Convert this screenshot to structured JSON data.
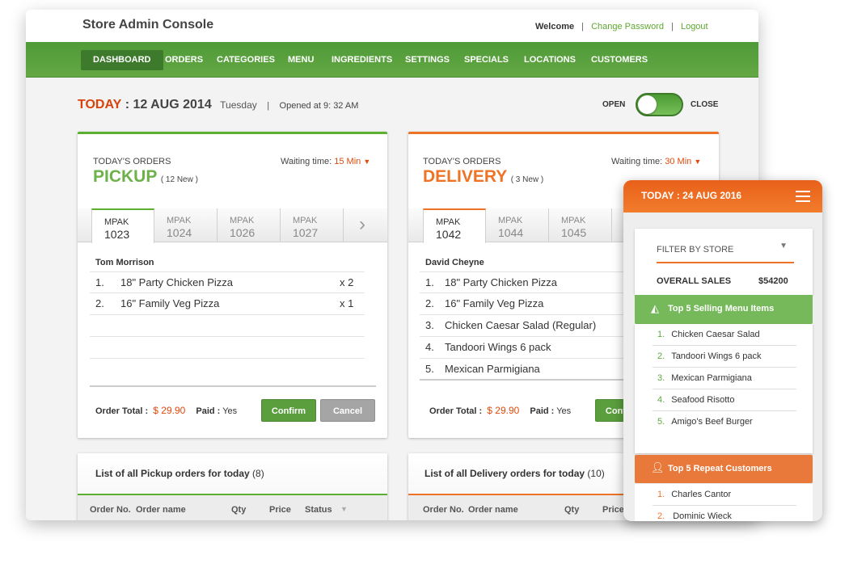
{
  "app": {
    "title": "Store Admin Console",
    "welcome": "Welcome",
    "change_password": "Change Password",
    "logout": "Logout",
    "sep": "|"
  },
  "nav": [
    "DASHBOARD",
    "ORDERS",
    "CATEGORIES",
    "MENU",
    "INGREDIENTS",
    "SETTINGS",
    "SPECIALS",
    "LOCATIONS",
    "CUSTOMERS"
  ],
  "nav_active": "DASHBOARD",
  "date": {
    "today": "TODAY",
    "date": ": 12 AUG 2014",
    "day": "Tuesday",
    "sep": "|",
    "opened": "Opened at 9: 32 AM"
  },
  "store_toggle": {
    "open": "OPEN",
    "close": "CLOSE",
    "state": "open"
  },
  "pickup": {
    "caption": "TODAY'S ORDERS",
    "title": "PICKUP",
    "new": "( 12 New )",
    "waiting_label": "Waiting time:",
    "waiting": "15 Min",
    "tabs": [
      {
        "p": "MPAK",
        "n": "1023"
      },
      {
        "p": "MPAK",
        "n": "1024"
      },
      {
        "p": "MPAK",
        "n": "1026"
      },
      {
        "p": "MPAK",
        "n": "1027"
      }
    ],
    "customer": "Tom Morrison",
    "items": [
      {
        "n": "1.",
        "name": "18\" Party Chicken Pizza",
        "q": "x  2"
      },
      {
        "n": "2.",
        "name": "16\" Family Veg Pizza",
        "q": "x  1"
      }
    ],
    "total_label": "Order Total :",
    "total": "$ 29.90",
    "paid_label": "Paid :",
    "paid": "Yes",
    "confirm": "Confirm",
    "cancel": "Cancel",
    "list_title": "List of all Pickup orders for today",
    "list_count": "(8)"
  },
  "delivery": {
    "caption": "TODAY'S ORDERS",
    "title": "DELIVERY",
    "new": "( 3 New )",
    "waiting_label": "Waiting time:",
    "waiting": "30 Min",
    "tabs": [
      {
        "p": "MPAK",
        "n": "1042"
      },
      {
        "p": "MPAK",
        "n": "1044"
      },
      {
        "p": "MPAK",
        "n": "1045"
      }
    ],
    "customer": "David Cheyne",
    "items": [
      {
        "n": "1.",
        "name": "18\" Party Chicken Pizza"
      },
      {
        "n": "2.",
        "name": "16\" Family Veg Pizza"
      },
      {
        "n": "3.",
        "name": "Chicken Caesar Salad (Regular)"
      },
      {
        "n": "4.",
        "name": "Tandoori Wings 6 pack"
      },
      {
        "n": "5.",
        "name": "Mexican Parmigiana"
      }
    ],
    "total_label": "Order Total :",
    "total": "$ 29.90",
    "paid_label": "Paid :",
    "paid": "Yes",
    "confirm": "Confirm",
    "list_title": "List of all Delivery orders for today",
    "list_count": "(10)"
  },
  "table_headers": [
    "Order No.",
    "Order name",
    "Qty",
    "Price",
    "Status"
  ],
  "mobile": {
    "title": "TODAY : 24 AUG 2016",
    "filter": "FILTER BY STORE",
    "sales_label": "OVERALL SALES",
    "sales": "$54200",
    "top_items_title": "Top 5 Selling Menu Items",
    "top_items": [
      {
        "n": "1.",
        "v": "Chicken Caesar Salad"
      },
      {
        "n": "2.",
        "v": "Tandoori Wings 6 pack"
      },
      {
        "n": "3.",
        "v": "Mexican Parmigiana"
      },
      {
        "n": "4.",
        "v": "Seafood Risotto"
      },
      {
        "n": "5.",
        "v": "Amigo's Beef Burger"
      }
    ],
    "top_customers_title": "Top 5 Repeat Customers",
    "top_customers": [
      {
        "n": "1.",
        "v": "Charles Cantor"
      },
      {
        "n": "2.",
        "v": "Dominic Wieck"
      }
    ]
  },
  "colors": {
    "green": "#5ea842",
    "orange": "#ef7326",
    "red": "#d9420b"
  }
}
